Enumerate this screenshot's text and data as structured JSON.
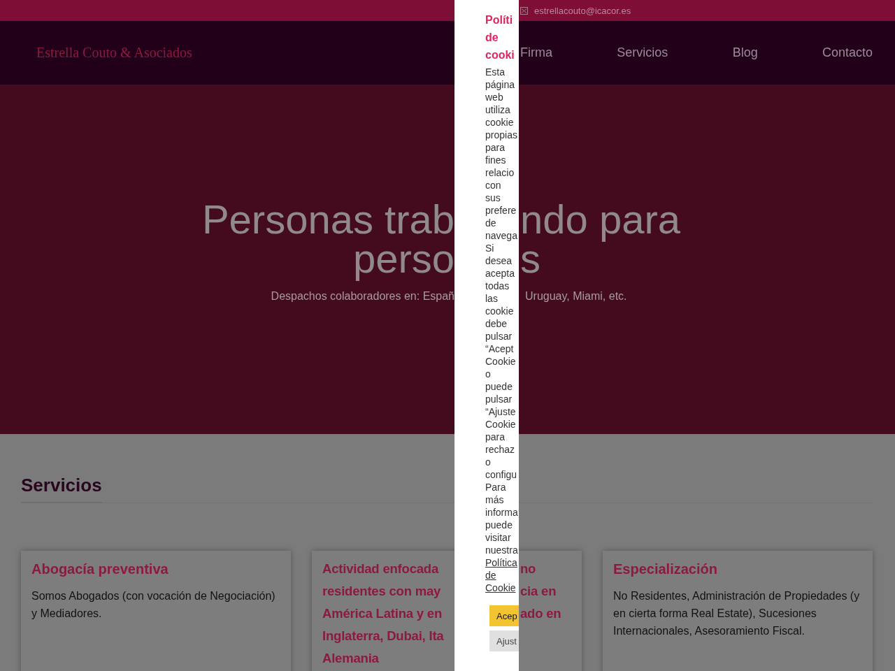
{
  "top_bar": {
    "email": "estrellacouto@icacor.es"
  },
  "header": {
    "logo": "Estrella Couto & Asociados",
    "nav": [
      "Firma",
      "Servicios",
      "Blog",
      "Contacto"
    ]
  },
  "hero": {
    "title_left": "Personas trab\nperso",
    "title_right": "ndo para\ns",
    "subtitle_left": "Despachos colaboradores en: Españ",
    "subtitle_right": "Uruguay, Miami, etc."
  },
  "services": {
    "heading": "Servicios",
    "cards": [
      {
        "kind": "full",
        "title": "Abogacía preventiva",
        "text": "Somos Abogados (con vocación de Negociación) y Mediadores."
      },
      {
        "kind": "split",
        "title_left": "Actividad enfocada\nresidentes con may\nAmérica Latina y en\nInglaterra, Dubai, Ita\nAlemania",
        "title_right": "no\ncia en\nado en"
      },
      {
        "kind": "full",
        "title": "Especialización",
        "text": "No Residentes, Administración de Propiedades (y en cierta forma Real Estate), Sucesiones Internacionales, Asesoramiento Fiscal."
      }
    ]
  },
  "cookie_dialog": {
    "title": "Políti de cooki",
    "text": "Esta página web utiliza cookie propias para fines relacio con sus prefere de navega Si desea acepta todas las cookie debe pulsar “Acept Cookie o puede pulsar “Ajuste Cookie para rechaz o configu Para más informa puede visitar nuestra",
    "link": "Política de Cookie",
    "buttons": [
      {
        "kind": "accept",
        "label": "Acep"
      },
      {
        "kind": "settings",
        "label": "Ajust"
      }
    ]
  }
}
